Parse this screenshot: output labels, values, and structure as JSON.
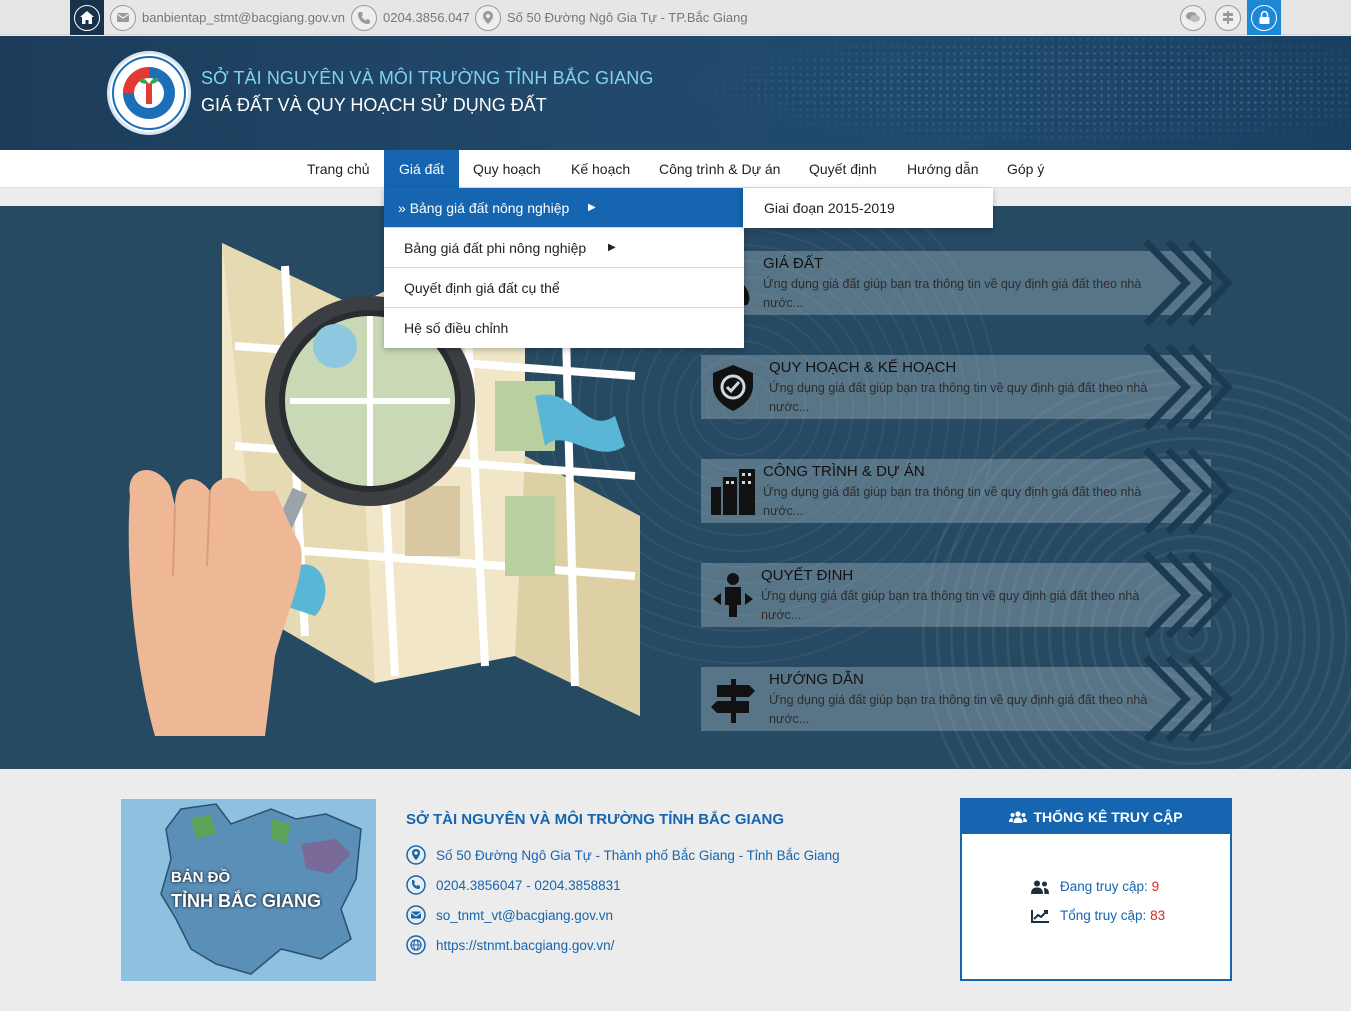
{
  "topbar": {
    "email": "banbientap_stmt@bacgiang.gov.vn",
    "phone": "0204.3856.047",
    "address": "Số 50 Đường Ngô Gia Tự - TP.Bắc Giang"
  },
  "header": {
    "title1": "SỞ TÀI NGUYÊN VÀ MÔI TRƯỜNG TỈNH BẮC GIANG",
    "title2": "GIÁ ĐẤT VÀ QUY HOẠCH SỬ DỤNG ĐẤT"
  },
  "nav": {
    "items": [
      "Trang chủ",
      "Giá đất",
      "Quy hoạch",
      "Kế hoạch",
      "Công trình & Dự án",
      "Quyết định",
      "Hướng dẫn",
      "Góp ý"
    ]
  },
  "dropdown": {
    "items": [
      "Bảng giá đất nông nghiệp",
      "Bảng giá đất phi nông nghiệp",
      "Quyết định giá đất cụ thể",
      "Hệ số điều chỉnh"
    ],
    "submenu": [
      "Giai đoạn 2015-2019"
    ]
  },
  "features": [
    {
      "title": "GIÁ ĐẤT",
      "desc": "Ứng dụng giá đất giúp bạn tra thông tin về quy định giá đất theo nhà nước..."
    },
    {
      "title": "QUY HOẠCH & KẾ HOẠCH",
      "desc": "Ứng dụng giá đất giúp bạn tra thông tin về quy định giá đất theo nhà nước..."
    },
    {
      "title": "CÔNG TRÌNH & DỰ ÁN",
      "desc": "Ứng dụng giá đất giúp bạn tra thông tin về quy định giá đất theo nhà nước..."
    },
    {
      "title": "QUYẾT ĐỊNH",
      "desc": "Ứng dụng giá đất giúp bạn tra thông tin về quy định giá đất theo nhà nước..."
    },
    {
      "title": "HƯỚNG DẪN",
      "desc": "Ứng dụng giá đất giúp bạn tra thông tin về quy định giá đất theo nhà nước..."
    }
  ],
  "footer": {
    "map_label1": "BẢN ĐỒ",
    "map_label2": "TỈNH BẮC GIANG",
    "title": "SỞ TÀI NGUYÊN VÀ MÔI TRƯỜNG TỈNH BẮC GIANG",
    "address": "Số 50 Đường Ngô Gia Tự - Thành phố Bắc Giang - Tỉnh Bắc Giang",
    "phone": "0204.3856047 - 0204.3858831",
    "email": "so_tnmt_vt@bacgiang.gov.vn",
    "website": "https://stnmt.bacgiang.gov.vn/"
  },
  "stats": {
    "title": "THỐNG KÊ TRUY CẬP",
    "online_label": "Đang truy cập:",
    "online_value": "9",
    "total_label": "Tổng truy cập:",
    "total_value": "83"
  },
  "colors": {
    "brand_blue": "#1565b0",
    "header_bg": "#1f4466",
    "hero_bg": "#264a62",
    "accent_red": "#d9251c"
  }
}
